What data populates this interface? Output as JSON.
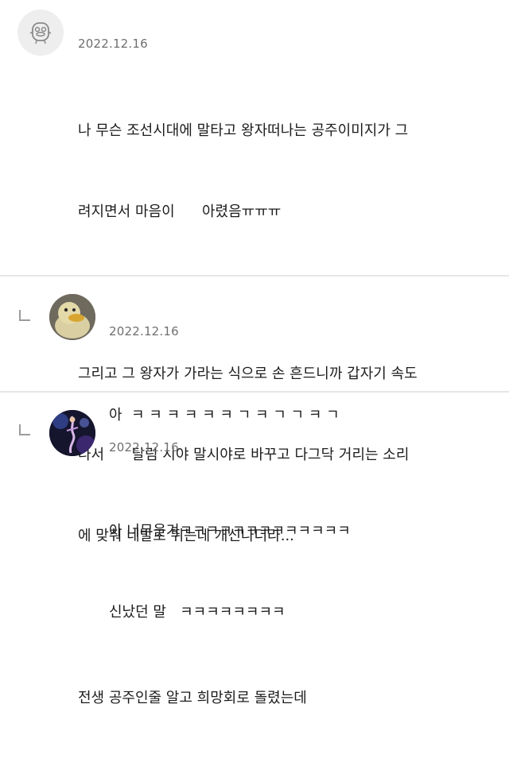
{
  "comments": [
    {
      "date": "2022.12.16",
      "avatar_icon": "duck-sticker-avatar-icon",
      "lines": [
        "나 무슨 조선시대에 말타고 왕자떠나는 공주이미지가 그",
        "려지면서 마음이      아렸음ㅠㅠㅠ",
        "",
        "그리고 그 왕자가 가라는 식으로 손 흔드니까 갑자기 속도",
        "나서      달림 시야 말시야로 바꾸고 다그닥 거리는 소리",
        "에 맞춰 네발로 뛰는데 개신나더라...",
        "",
        "전생 공주인줄 알고 희망회로 돌렸는데"
      ]
    },
    {
      "date": "2022.12.16",
      "avatar_icon": "duckling-plush-avatar-icon",
      "lines": [
        "아  ㅋ ㅋ ㅋ ㅋ ㅋ ㅋ ㄱ ㅋ ㄱ ㄱ ㅋ ㄱ"
      ]
    },
    {
      "date": "2022.12.16",
      "avatar_icon": "figure-art-avatar-icon",
      "lines": [
        "아 너무웃겨ㅋㅋㅋㅋㅋㅋㅋㅋㅋㅋㅋㅋㅋ",
        "신났던 말   ㅋㅋㅋㅋㅋㅋㅋㅋ"
      ]
    }
  ]
}
